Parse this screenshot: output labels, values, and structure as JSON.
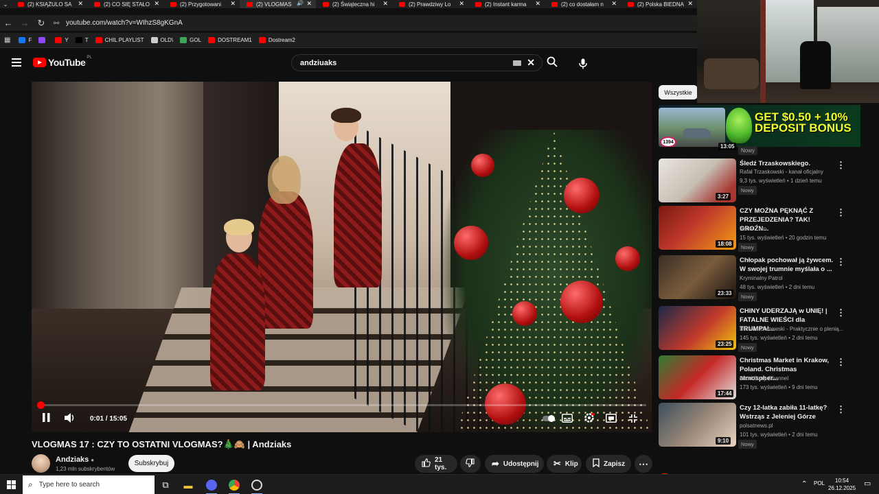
{
  "browser": {
    "tabs": [
      {
        "label": "(2) KSIĄŻULO SA"
      },
      {
        "label": "(2) CO SIĘ STAŁO"
      },
      {
        "label": "(2) Przygotowani"
      },
      {
        "label": "(2) VLOGMAS",
        "active": true
      },
      {
        "label": "(2) Świąteczna hi"
      },
      {
        "label": "(2) Prawdziwy Lo"
      },
      {
        "label": "(2) Instant karma"
      },
      {
        "label": "(2) co dostałam n"
      },
      {
        "label": "(2) Polska BIEDNA"
      }
    ],
    "url": "youtube.com/watch?v=WIhzS8gKGnA",
    "bookmarks": [
      {
        "label": "F",
        "color": "#1877f2"
      },
      {
        "label": "",
        "color": "#9146ff"
      },
      {
        "label": "Y",
        "color": "#ff0000"
      },
      {
        "label": "T",
        "color": "#000000"
      },
      {
        "label": "CHIL PLAYLIST",
        "color": "#ff0000"
      },
      {
        "label": "OLD\\",
        "color": "#cccccc"
      },
      {
        "label": "GOL",
        "color": "#3aa757"
      },
      {
        "label": "DOSTREAM1",
        "color": "#ff0000"
      },
      {
        "label": "Dostream2",
        "color": "#ff0000"
      }
    ]
  },
  "youtube": {
    "logo_text": "YouTube",
    "country_code": "PL",
    "search_query": "andziuaks"
  },
  "player": {
    "time_current": "0:01",
    "time_total": "15:05",
    "progress": 0.002
  },
  "video": {
    "title": "VLOGMAS 17 : CZY TO OSTATNI VLOGMAS?🎄🙈 | Andziaks",
    "channel": "Andziaks",
    "subscribers": "1,23 mln subskrybentów",
    "subscribe_label": "Subskrybuj",
    "likes": "21 tys.",
    "share_label": "Udostępnij",
    "clip_label": "Klip",
    "save_label": "Zapisz"
  },
  "sidebar": {
    "chip": "Wszystkie",
    "ad": {
      "badge": "1394",
      "duration": "13:05",
      "text": "GET $0.50 + 10% DEPOSIT BONUS",
      "new_label": "Nowy"
    },
    "items": [
      {
        "title": "Śledź Trzaskowskiego.",
        "channel": "Rafał Trzaskowski - kanał oficjalny",
        "meta": "9,3 tys. wyświetleń • 1 dzień temu",
        "duration": "3:27",
        "new": "Nowy"
      },
      {
        "title": "CZY MOŻNA PĘKNĄĆ Z PRZEJEDZENIA? TAK! GROŹN...",
        "channel": "Kanał Zero",
        "meta": "15 tys. wyświetleń • 20 godzin temu",
        "duration": "18:08",
        "new": "Nowy"
      },
      {
        "title": "Chłopak pochował ją żywcem. W swojej trumnie myślała o ...",
        "channel": "Kryminalny Patrol",
        "meta": "48 tys. wyświetleń • 2 dni temu",
        "duration": "23:33",
        "new": "Nowy"
      },
      {
        "title": "CHINY UDERZAJĄ w UNIĘ! | FATALNE WIEŚCI dla TRUMPA!...",
        "channel": "Damian Olszewski - Praktycznie o plenią...",
        "meta": "145 tys. wyświetleń • 2 dni temu",
        "duration": "23:25",
        "new": "Nowy"
      },
      {
        "title": "Christmas Market in Krakow, Poland. Christmas atmospher...",
        "channel": "Food Story Channel",
        "meta": "173 tys. wyświetleń • 9 dni temu",
        "duration": "17:44",
        "new": ""
      },
      {
        "title": "Czy 12-latka zabiła 11-latkę? Wstrząs z Jeleniej Górze",
        "channel": "polsatnews.pl",
        "meta": "101 tys. wyświetleń • 2 dni temu",
        "duration": "9:10",
        "new": "Nowy"
      }
    ]
  },
  "taskbar": {
    "search_placeholder": "Type here to search",
    "language": "POL",
    "time": "10:54",
    "date": "26.12.2025"
  }
}
